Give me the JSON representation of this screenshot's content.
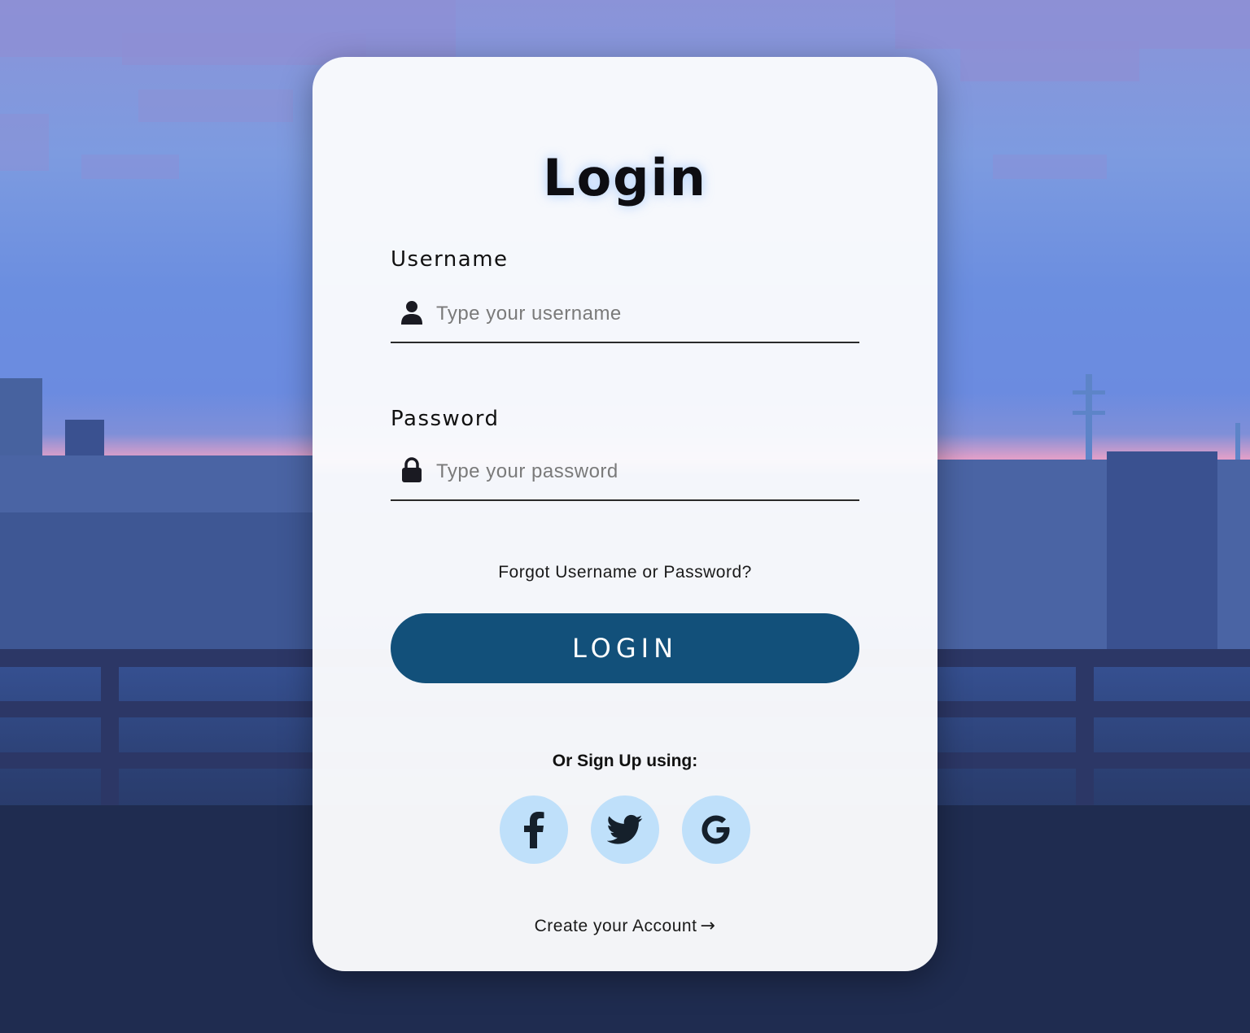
{
  "card": {
    "title": "Login",
    "username": {
      "label": "Username",
      "placeholder": "Type your username",
      "icon": "user-icon"
    },
    "password": {
      "label": "Password",
      "placeholder": "Type your password",
      "icon": "lock-icon"
    },
    "forgot_link": "Forgot Username or Password?",
    "login_button": "LOGIN",
    "signup_prompt": "Or Sign Up using:",
    "social": [
      {
        "name": "facebook",
        "icon": "facebook-icon"
      },
      {
        "name": "twitter",
        "icon": "twitter-icon"
      },
      {
        "name": "google",
        "icon": "google-icon"
      }
    ],
    "create_account": "Create your Account",
    "create_arrow": "→"
  },
  "colors": {
    "login_button_bg": "#12507a",
    "social_bg": "#bfe0fa",
    "card_bg": "#fafbfd"
  }
}
